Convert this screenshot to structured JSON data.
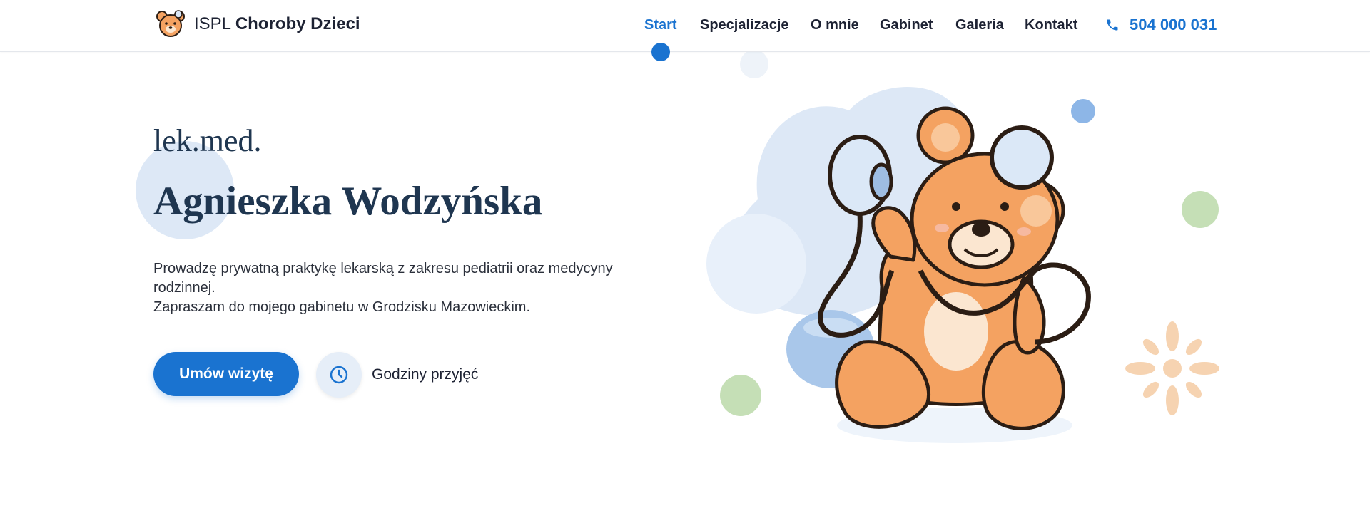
{
  "header": {
    "brand_prefix": "ISPL",
    "brand_name": "Choroby Dzieci",
    "nav": [
      {
        "label": "Start",
        "active": true
      },
      {
        "label": "Specjalizacje",
        "active": false
      },
      {
        "label": "O mnie",
        "active": false
      },
      {
        "label": "Gabinet",
        "active": false
      },
      {
        "label": "Galeria",
        "active": false
      },
      {
        "label": "Kontakt",
        "active": false
      }
    ],
    "phone": "504 000 031",
    "phone_icon": "phone-icon",
    "logo_icon": "teddy-bear-logo"
  },
  "hero": {
    "subtitle": "lek.med.",
    "title": "Agnieszka Wodzyńska",
    "description_lines": [
      "Prowadzę prywatną praktykę lekarską z zakresu pediatrii oraz medycyny rodzinnej.",
      "Zapraszam do mojego gabinetu w Grodzisku Mazowieckim."
    ],
    "cta_label": "Umów wizytę",
    "hours_label": "Godziny przyjęć",
    "hours_icon": "clock-icon",
    "illustration": "teddy-bear-with-stethoscope"
  },
  "colors": {
    "accent": "#1a73d0",
    "heading": "#1f3650",
    "bear": "#f4a261",
    "blob_blue": "#dde8f6",
    "dot_green": "#c5dfb6",
    "dot_blue": "#8db6e7",
    "flower": "#f6d3b1"
  }
}
